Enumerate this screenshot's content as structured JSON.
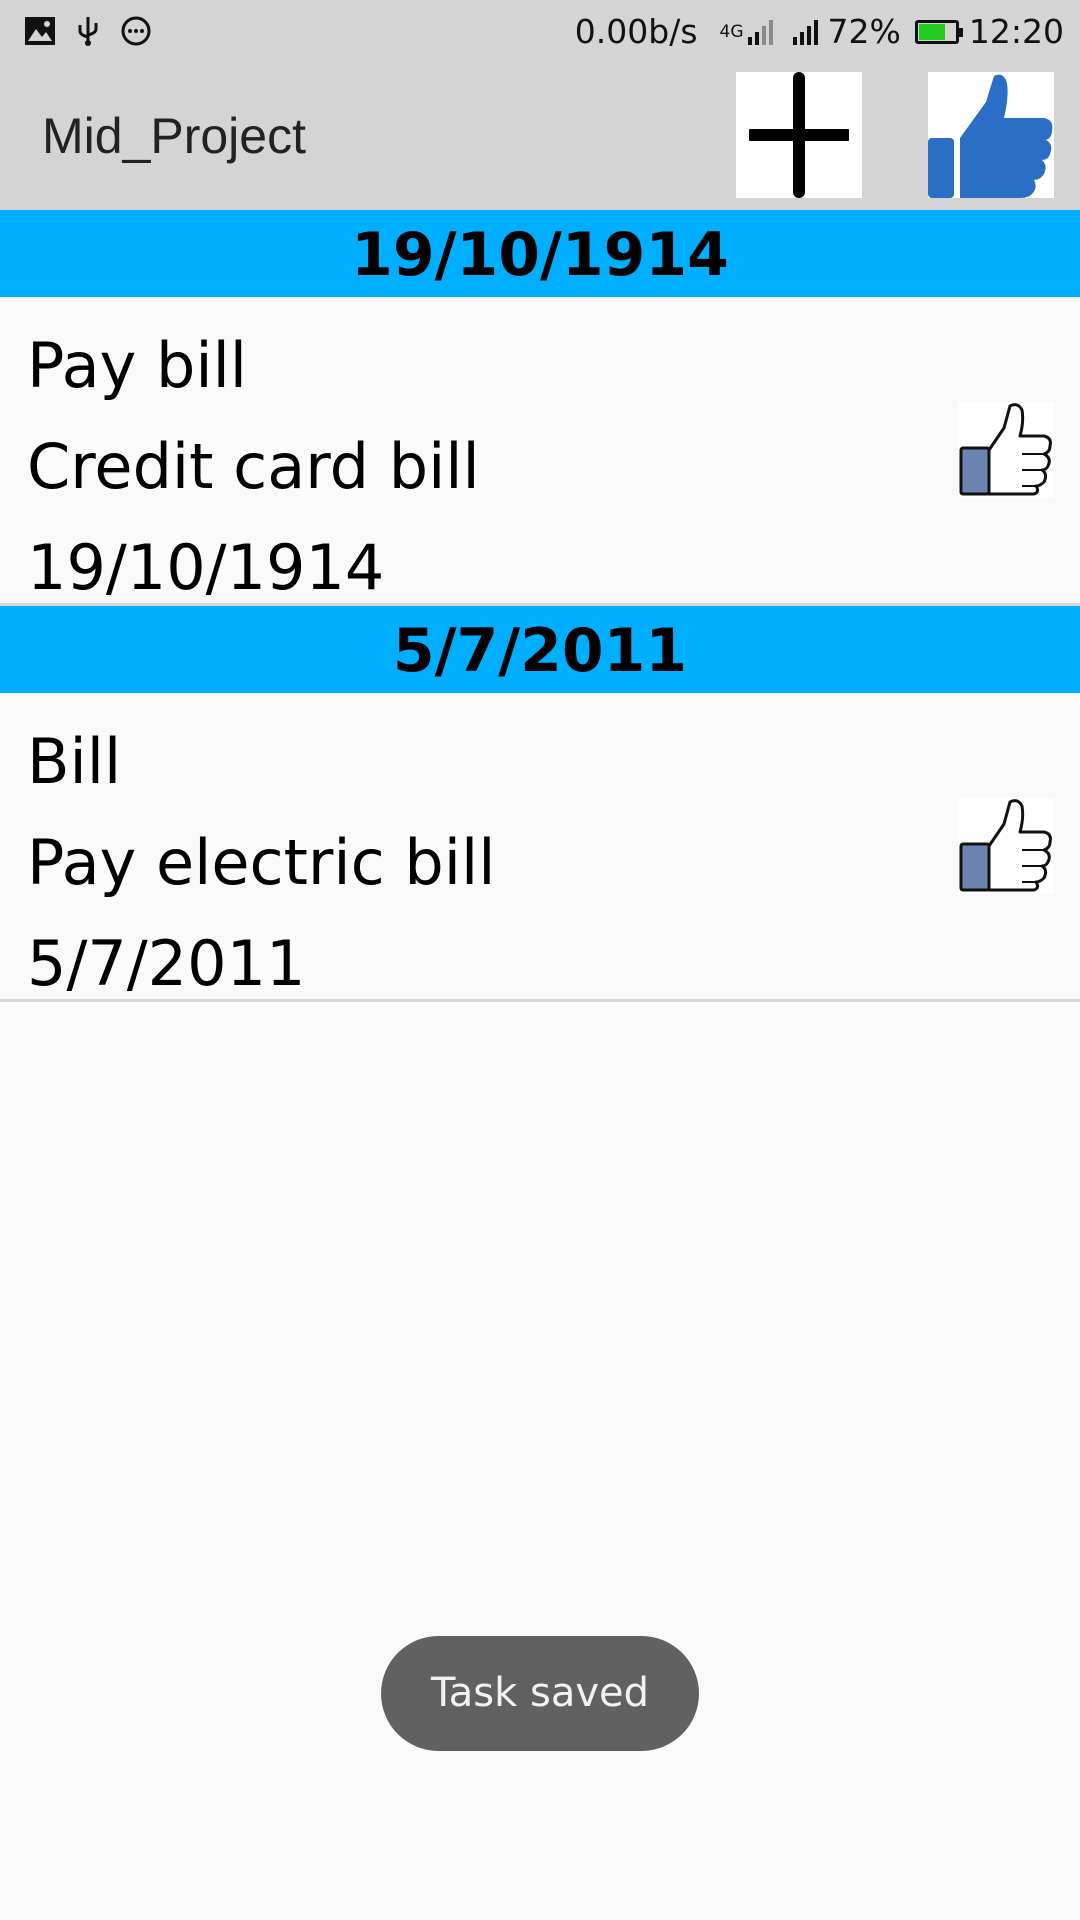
{
  "status_bar": {
    "left_icons": [
      "image-icon",
      "usb-icon",
      "more-icon"
    ],
    "net_speed": "0.00b/s",
    "network_label": "4G",
    "battery_percent": "72%",
    "battery_level": 0.72,
    "battery_color": "#22cc22",
    "time": "12:20"
  },
  "app_bar": {
    "title": "Mid_Project",
    "actions": [
      "add-icon",
      "thumbs-up-icon"
    ],
    "like_color": "#2a6ec5"
  },
  "sections": [
    {
      "header": "19/10/1914",
      "items": [
        {
          "title": "Pay bill",
          "description": "Credit card bill",
          "date": "19/10/1914",
          "icon": "thumbs-up-outline-icon"
        }
      ]
    },
    {
      "header": "5/7/2011",
      "items": [
        {
          "title": "Bill",
          "description": "Pay electric bill",
          "date": "5/7/2011",
          "icon": "thumbs-up-outline-icon"
        }
      ]
    }
  ],
  "colors": {
    "section_header": "#00aeff",
    "app_bar": "#d4d4d4",
    "toast_bg": "#616161"
  },
  "toast": {
    "message": "Task saved"
  }
}
